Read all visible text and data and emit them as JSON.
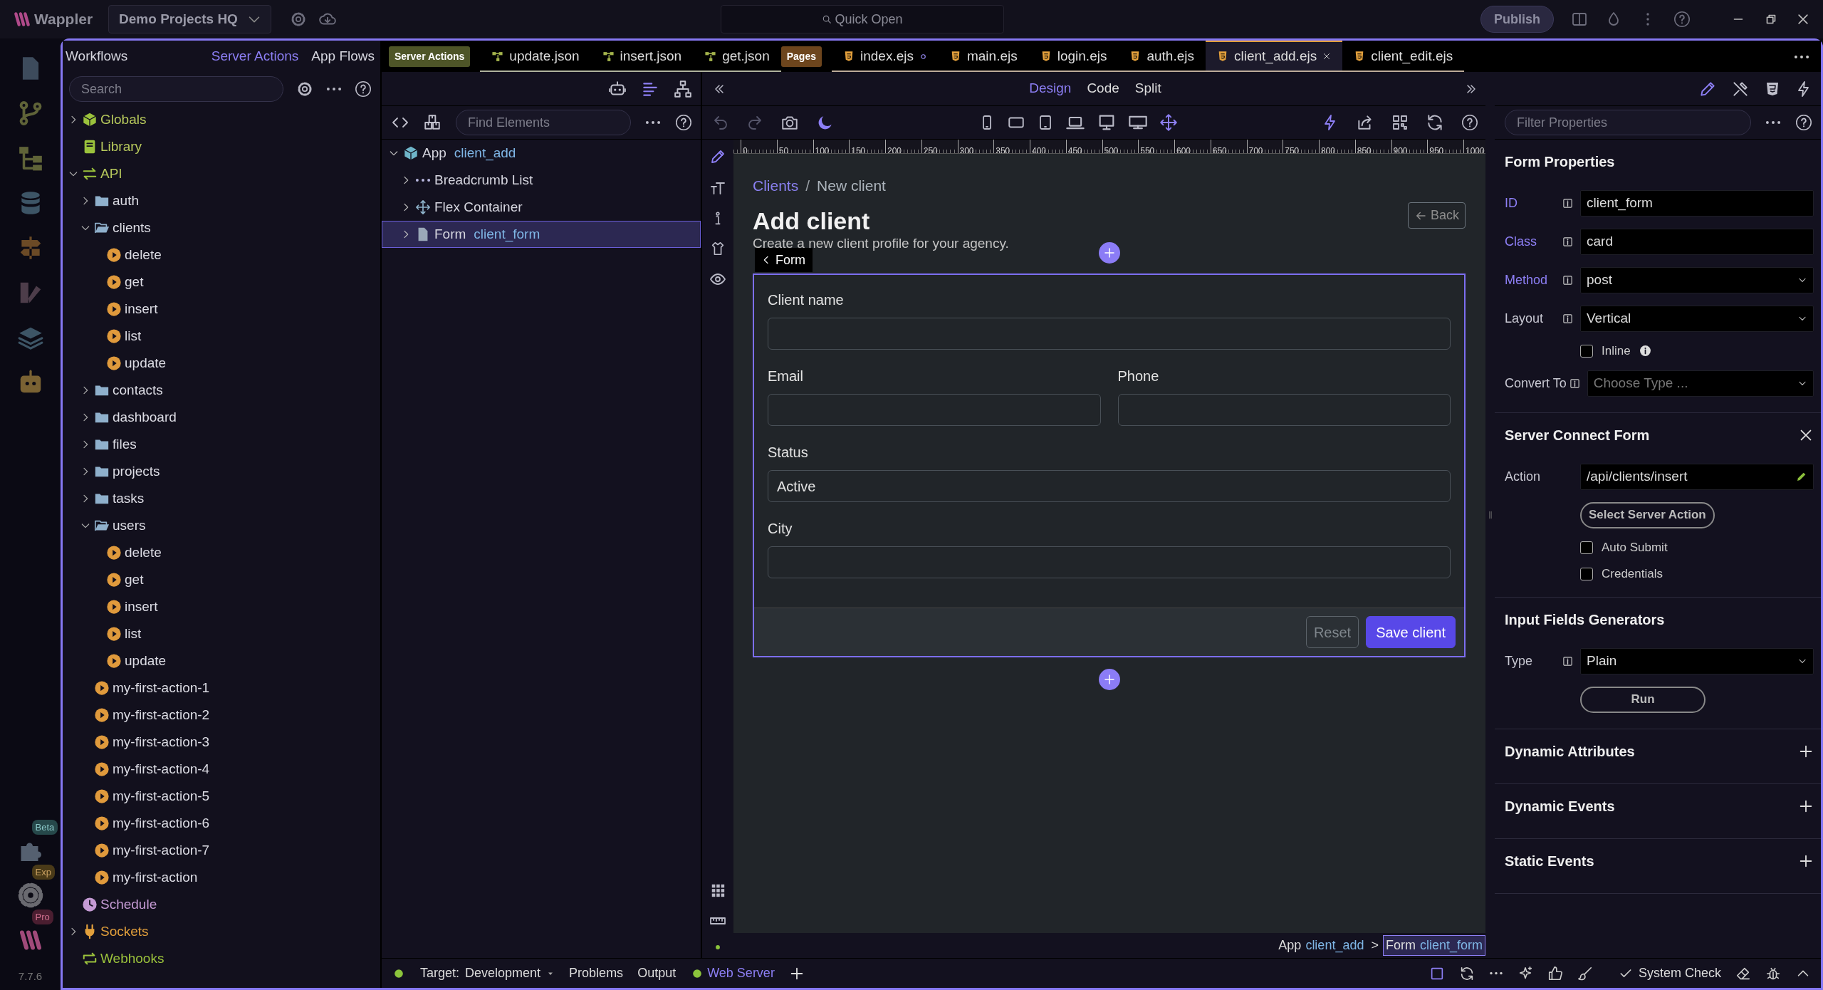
{
  "title_bar": {
    "app_name": "Wappler",
    "project": "Demo Projects HQ",
    "quick_open": "Quick Open",
    "publish": "Publish"
  },
  "activity_bar": {
    "badges": [
      "Beta",
      "Exp",
      "Pro"
    ],
    "version": "7.7.6"
  },
  "workflows": {
    "title": "Workflows",
    "tabs": [
      {
        "label": "Server Actions",
        "selected": true
      },
      {
        "label": "App Flows",
        "selected": false
      }
    ],
    "search": {
      "placeholder": "Search"
    },
    "tree": [
      {
        "kind": "globals",
        "label": "Globals",
        "expanded": false
      },
      {
        "kind": "library",
        "label": "Library"
      },
      {
        "kind": "api",
        "label": "API",
        "expanded": true,
        "children": [
          {
            "kind": "folder",
            "label": "auth",
            "expanded": false
          },
          {
            "kind": "folder",
            "label": "clients",
            "expanded": true,
            "children": [
              {
                "kind": "action",
                "label": "delete"
              },
              {
                "kind": "action",
                "label": "get"
              },
              {
                "kind": "action",
                "label": "insert"
              },
              {
                "kind": "action",
                "label": "list"
              },
              {
                "kind": "action",
                "label": "update"
              }
            ]
          },
          {
            "kind": "folder",
            "label": "contacts",
            "expanded": false
          },
          {
            "kind": "folder",
            "label": "dashboard",
            "expanded": false
          },
          {
            "kind": "folder",
            "label": "files",
            "expanded": false
          },
          {
            "kind": "folder",
            "label": "projects",
            "expanded": false
          },
          {
            "kind": "folder",
            "label": "tasks",
            "expanded": false
          },
          {
            "kind": "folder",
            "label": "users",
            "expanded": true,
            "children": [
              {
                "kind": "action",
                "label": "delete"
              },
              {
                "kind": "action",
                "label": "get"
              },
              {
                "kind": "action",
                "label": "insert"
              },
              {
                "kind": "action",
                "label": "list"
              },
              {
                "kind": "action",
                "label": "update"
              }
            ]
          },
          {
            "kind": "action",
            "label": "my-first-action-1"
          },
          {
            "kind": "action",
            "label": "my-first-action-2"
          },
          {
            "kind": "action",
            "label": "my-first-action-3"
          },
          {
            "kind": "action",
            "label": "my-first-action-4"
          },
          {
            "kind": "action",
            "label": "my-first-action-5"
          },
          {
            "kind": "action",
            "label": "my-first-action-6"
          },
          {
            "kind": "action",
            "label": "my-first-action-7"
          },
          {
            "kind": "action",
            "label": "my-first-action"
          }
        ]
      },
      {
        "kind": "schedule",
        "label": "Schedule"
      },
      {
        "kind": "sockets",
        "label": "Sockets",
        "expanded": false
      },
      {
        "kind": "webhooks",
        "label": "Webhooks"
      }
    ]
  },
  "editor_tabs": [
    {
      "kind": "group",
      "label": "Server Actions",
      "color": "#4e5528"
    },
    {
      "kind": "json",
      "label": "update.json",
      "selected": false,
      "modified": false
    },
    {
      "kind": "json",
      "label": "insert.json",
      "selected": false,
      "modified": false
    },
    {
      "kind": "json",
      "label": "get.json",
      "selected": false,
      "modified": false
    },
    {
      "kind": "group",
      "label": "Pages",
      "color": "#6d451d"
    },
    {
      "kind": "ejs",
      "label": "index.ejs",
      "selected": false,
      "modified": true
    },
    {
      "kind": "ejs",
      "label": "main.ejs",
      "selected": false,
      "modified": false
    },
    {
      "kind": "ejs",
      "label": "login.ejs",
      "selected": false,
      "modified": false
    },
    {
      "kind": "ejs",
      "label": "auth.ejs",
      "selected": false,
      "modified": false
    },
    {
      "kind": "ejs",
      "label": "client_add.ejs",
      "selected": true,
      "modified": false
    },
    {
      "kind": "ejs",
      "label": "client_edit.ejs",
      "selected": false,
      "modified": false
    }
  ],
  "structure": {
    "search": {
      "placeholder": "Find Elements"
    },
    "tree": [
      {
        "kind": "app",
        "label": "App",
        "id": "client_add",
        "expanded": true,
        "selected": false,
        "children": [
          {
            "kind": "breadcrumb",
            "label": "Breadcrumb List",
            "expanded": false,
            "selected": false
          },
          {
            "kind": "flex",
            "label": "Flex Container",
            "expanded": false,
            "selected": false
          },
          {
            "kind": "form",
            "label": "Form",
            "id": "client_form",
            "expanded": false,
            "selected": true
          }
        ]
      }
    ]
  },
  "design": {
    "modes": [
      {
        "label": "Design",
        "selected": true
      },
      {
        "label": "Code",
        "selected": false
      },
      {
        "label": "Split",
        "selected": false
      }
    ],
    "ruler": [
      "0",
      "50",
      "100",
      "150",
      "200",
      "250",
      "300",
      "350",
      "400",
      "450",
      "500",
      "550",
      "600",
      "650",
      "700",
      "750",
      "800",
      "850",
      "900",
      "950",
      "1000"
    ],
    "canvas": {
      "breadcrumb": {
        "separator": "/",
        "items": [
          {
            "label": "Clients",
            "active": false
          },
          {
            "label": "New client",
            "active": true
          }
        ]
      },
      "title": "Add client",
      "subtitle": "Create a new client profile for your agency.",
      "back": "Back",
      "form_tag": "Form",
      "rows": [
        [
          {
            "kind": "text",
            "label": "Client name"
          }
        ],
        [
          {
            "kind": "text",
            "label": "Email"
          },
          {
            "kind": "text",
            "label": "Phone"
          }
        ],
        [
          {
            "kind": "select",
            "label": "Status",
            "value": "Active"
          }
        ],
        [
          {
            "kind": "text",
            "label": "City"
          }
        ]
      ],
      "buttons": [
        {
          "kind": "secondary",
          "label": "Reset"
        },
        {
          "kind": "primary",
          "label": "Save client"
        }
      ]
    },
    "element_path": {
      "separator": ">",
      "items": [
        {
          "label": "App",
          "id": "client_add",
          "selected": false
        },
        {
          "label": "Form",
          "id": "client_form",
          "selected": true
        }
      ]
    }
  },
  "properties": {
    "filter": {
      "placeholder": "Filter Properties"
    },
    "sections": [
      {
        "kind": "plain",
        "title": "Form Properties",
        "rows": [
          {
            "kind": "input",
            "label": "ID",
            "value": "client_form",
            "set": true,
            "info": true
          },
          {
            "kind": "input",
            "label": "Class",
            "value": "card",
            "set": true,
            "info": true
          },
          {
            "kind": "select",
            "label": "Method",
            "value": "post",
            "set": true,
            "info": true
          },
          {
            "kind": "select",
            "label": "Layout",
            "value": "Vertical",
            "set": false,
            "info": true
          },
          {
            "kind": "checkbox",
            "label": "Inline",
            "checked": false,
            "info": true
          },
          {
            "kind": "select",
            "label": "Convert To",
            "placeholder": "Choose Type ...",
            "set": false,
            "info": true
          }
        ]
      },
      {
        "kind": "removable",
        "title": "Server Connect Form",
        "rows": [
          {
            "kind": "picker",
            "label": "Action",
            "value": "/api/clients/insert",
            "set": false,
            "info": false
          },
          {
            "kind": "button",
            "label": "Select Server Action"
          },
          {
            "kind": "checkbox",
            "label": "Auto Submit",
            "checked": false,
            "info": false
          },
          {
            "kind": "checkbox",
            "label": "Credentials",
            "checked": false,
            "info": false
          }
        ]
      },
      {
        "kind": "plain",
        "title": "Input Fields Generators",
        "rows": [
          {
            "kind": "select",
            "label": "Type",
            "value": "Plain",
            "set": false,
            "info": true
          },
          {
            "kind": "button",
            "label": "Run"
          }
        ]
      },
      {
        "kind": "addable",
        "title": "Dynamic Attributes"
      },
      {
        "kind": "addable",
        "title": "Dynamic Events"
      },
      {
        "kind": "addable",
        "title": "Static Events"
      }
    ]
  },
  "status_bar": {
    "target": {
      "label": "Target:",
      "value": "Development"
    },
    "panels": [
      "Problems",
      "Output"
    ],
    "server": "Web Server",
    "system_check": "System Check"
  }
}
